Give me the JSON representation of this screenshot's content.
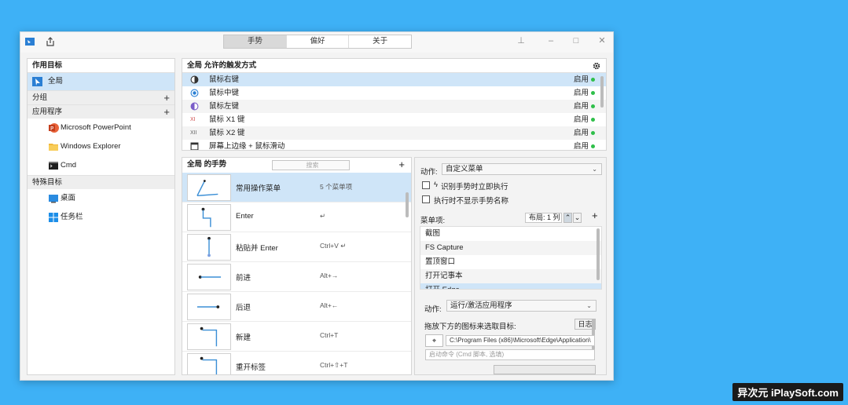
{
  "tabs": [
    "手势",
    "偏好",
    "关于"
  ],
  "targets": {
    "header": "作用目标",
    "global_item": "全局",
    "groups_header": "分组",
    "apps_header": "应用程序",
    "apps": [
      "Microsoft PowerPoint",
      "Windows Explorer",
      "Cmd"
    ],
    "special_header": "特殊目标",
    "special": [
      "桌面",
      "任务栏"
    ]
  },
  "triggers": {
    "header": "全局 允许的触发方式",
    "items": [
      {
        "label": "鼠标右键",
        "status": "启用"
      },
      {
        "label": "鼠标中键",
        "status": "启用"
      },
      {
        "label": "鼠标左键",
        "status": "启用"
      },
      {
        "label": "鼠标 X1 键",
        "status": "启用"
      },
      {
        "label": "鼠标 X2 键",
        "status": "启用"
      },
      {
        "label": "屏幕上边缘 + 鼠标滑动",
        "status": "启用"
      }
    ]
  },
  "gestures": {
    "header": "全局 的手势",
    "search_placeholder": "搜索",
    "items": [
      {
        "name": "常用操作菜单",
        "key": "5 个菜单项"
      },
      {
        "name": "Enter",
        "key": "↵"
      },
      {
        "name": "粘贴并 Enter",
        "key": "Ctrl+V ↵"
      },
      {
        "name": "前进",
        "key": "Alt+→"
      },
      {
        "name": "后退",
        "key": "Alt+←"
      },
      {
        "name": "新建",
        "key": "Ctrl+T"
      },
      {
        "name": "重开标签",
        "key": "Ctrl+⇧+T"
      }
    ]
  },
  "action": {
    "label": "动作:",
    "value": "自定义菜单",
    "check1": "识别手势时立即执行",
    "check2": "执行时不显示手势名称",
    "menu_items_label": "菜单项:",
    "layout_label": "布局: 1 列",
    "menu_items": [
      "截图",
      "FS Capture",
      "置顶窗口",
      "打开记事本",
      "打开 Edge"
    ],
    "sub_action_label": "动作:",
    "sub_action_value": "运行/激活应用程序",
    "drag_label": "拖放下方的图标来选取目标:",
    "log_button": "日志",
    "path_value": "C:\\Program Files (x86)\\Microsoft\\Edge\\Application\\",
    "cmd_placeholder": "启动命令 (Cmd 脚本, 选填)"
  },
  "watermark": "异次元 iPlaySoft.com"
}
